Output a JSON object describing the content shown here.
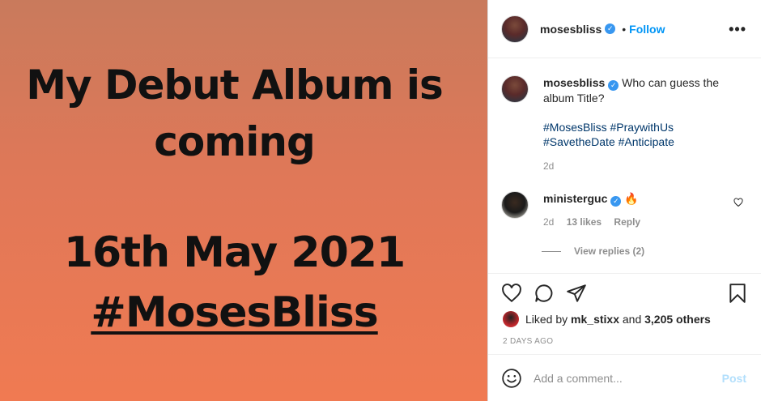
{
  "media": {
    "line1": "My Debut Album is",
    "line2": "coming",
    "line3": "16th May 2021",
    "line4": "#MosesBliss",
    "background_top": "#c97a5c",
    "background_bottom": "#f07a52"
  },
  "header": {
    "username": "mosesbliss",
    "separator": "•",
    "follow_label": "Follow",
    "more_label": "•••"
  },
  "caption": {
    "username": "mosesbliss",
    "text": "Who can guess the album Title?",
    "tags_line1": "#MosesBliss #PraywithUs",
    "tags_line2": "#SavetheDate #Anticipate",
    "age": "2d"
  },
  "comment": {
    "username": "ministerguc",
    "text": "🔥",
    "age": "2d",
    "likes": "13 likes",
    "reply_label": "Reply",
    "view_replies": "View replies (2)"
  },
  "icons": [
    "heart-icon",
    "comment-icon",
    "share-icon",
    "bookmark-icon",
    "smile-icon"
  ],
  "likes": {
    "prefix": "Liked by",
    "user": "mk_stixx",
    "middle": "and",
    "others": "3,205 others"
  },
  "timestamp": "2 DAYS AGO",
  "add_comment": {
    "placeholder": "Add a comment...",
    "post_label": "Post"
  },
  "colors": {
    "accent": "#0095f6",
    "verified": "#3897f0",
    "hashtag": "#00376b",
    "muted": "#8e8e8e",
    "post_disabled": "#b2dffc"
  }
}
